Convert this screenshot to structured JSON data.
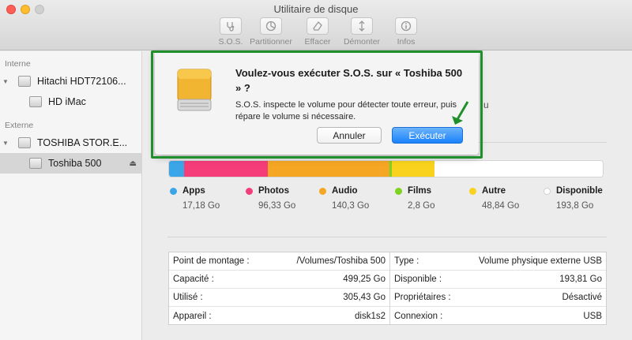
{
  "window": {
    "title": "Utilitaire de disque"
  },
  "toolbar": {
    "buttons": [
      {
        "label": "S.O.S.",
        "icon": "stethoscope-icon"
      },
      {
        "label": "Partitionner",
        "icon": "partition-icon"
      },
      {
        "label": "Effacer",
        "icon": "erase-icon"
      },
      {
        "label": "Démonter",
        "icon": "unmount-icon"
      },
      {
        "label": "Infos",
        "icon": "info-icon"
      }
    ]
  },
  "sidebar": {
    "sections": [
      {
        "header": "Interne",
        "items": [
          "Hitachi HDT72106...",
          "HD iMac"
        ]
      },
      {
        "header": "Externe",
        "items": [
          "TOSHIBA STOR.E...",
          "Toshiba 500"
        ]
      }
    ],
    "selected": "Toshiba 500"
  },
  "dialog": {
    "title": "Voulez-vous exécuter S.O.S. sur « Toshiba 500 » ?",
    "body": "S.O.S. inspecte le volume pour détecter toute erreur, puis répare le volume si nécessaire.",
    "cancel_label": "Annuler",
    "execute_label": "Exécuter"
  },
  "background_fragment": "u",
  "usage": {
    "capacity_go": 499.25,
    "categories": [
      {
        "name": "Apps",
        "value": "17,18 Go",
        "go": 17.18,
        "color": "#3aa6e8"
      },
      {
        "name": "Photos",
        "value": "96,33 Go",
        "go": 96.33,
        "color": "#f53d7a"
      },
      {
        "name": "Audio",
        "value": "140,3 Go",
        "go": 140.3,
        "color": "#f5a623"
      },
      {
        "name": "Films",
        "value": "2,8 Go",
        "go": 2.8,
        "color": "#7ed321"
      },
      {
        "name": "Autre",
        "value": "48,84 Go",
        "go": 48.84,
        "color": "#f8d21c"
      },
      {
        "name": "Disponible",
        "value": "193,8 Go",
        "go": 193.8,
        "color": "#ffffff"
      }
    ]
  },
  "info": {
    "left": [
      {
        "label": "Point de montage :",
        "value": "/Volumes/Toshiba 500"
      },
      {
        "label": "Capacité :",
        "value": "499,25 Go"
      },
      {
        "label": "Utilisé :",
        "value": "305,43 Go"
      },
      {
        "label": "Appareil :",
        "value": "disk1s2"
      }
    ],
    "right": [
      {
        "label": "Type :",
        "value": "Volume physique externe USB"
      },
      {
        "label": "Disponible :",
        "value": "193,81 Go"
      },
      {
        "label": "Propriétaires :",
        "value": "Désactivé"
      },
      {
        "label": "Connexion :",
        "value": "USB"
      }
    ]
  }
}
